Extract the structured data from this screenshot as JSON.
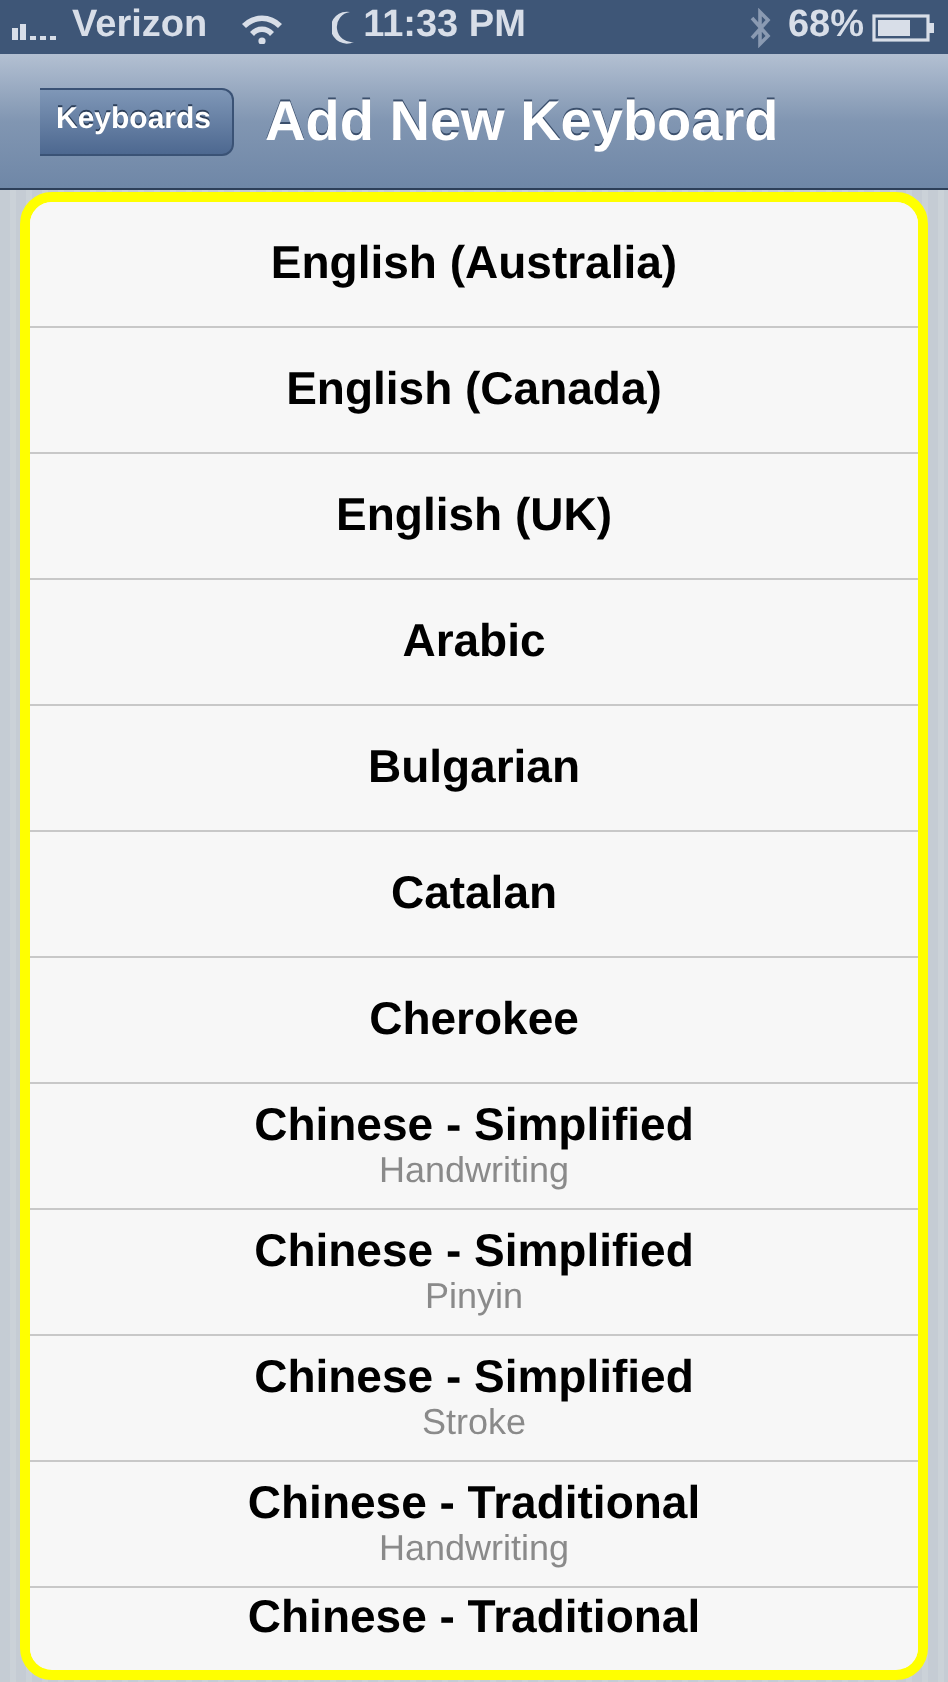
{
  "status_bar": {
    "carrier": "Verizon",
    "time": "11:33 PM",
    "battery": "68%"
  },
  "nav_bar": {
    "back_button": "Keyboards",
    "title": "Add New Keyboard"
  },
  "keyboards": [
    {
      "name": "English (Australia)"
    },
    {
      "name": "English (Canada)"
    },
    {
      "name": "English (UK)"
    },
    {
      "name": "Arabic"
    },
    {
      "name": "Bulgarian"
    },
    {
      "name": "Catalan"
    },
    {
      "name": "Cherokee"
    },
    {
      "name": "Chinese - Simplified",
      "subtitle": "Handwriting"
    },
    {
      "name": "Chinese - Simplified",
      "subtitle": "Pinyin"
    },
    {
      "name": "Chinese - Simplified",
      "subtitle": "Stroke"
    },
    {
      "name": "Chinese - Traditional",
      "subtitle": "Handwriting"
    },
    {
      "name": "Chinese - Traditional"
    }
  ]
}
